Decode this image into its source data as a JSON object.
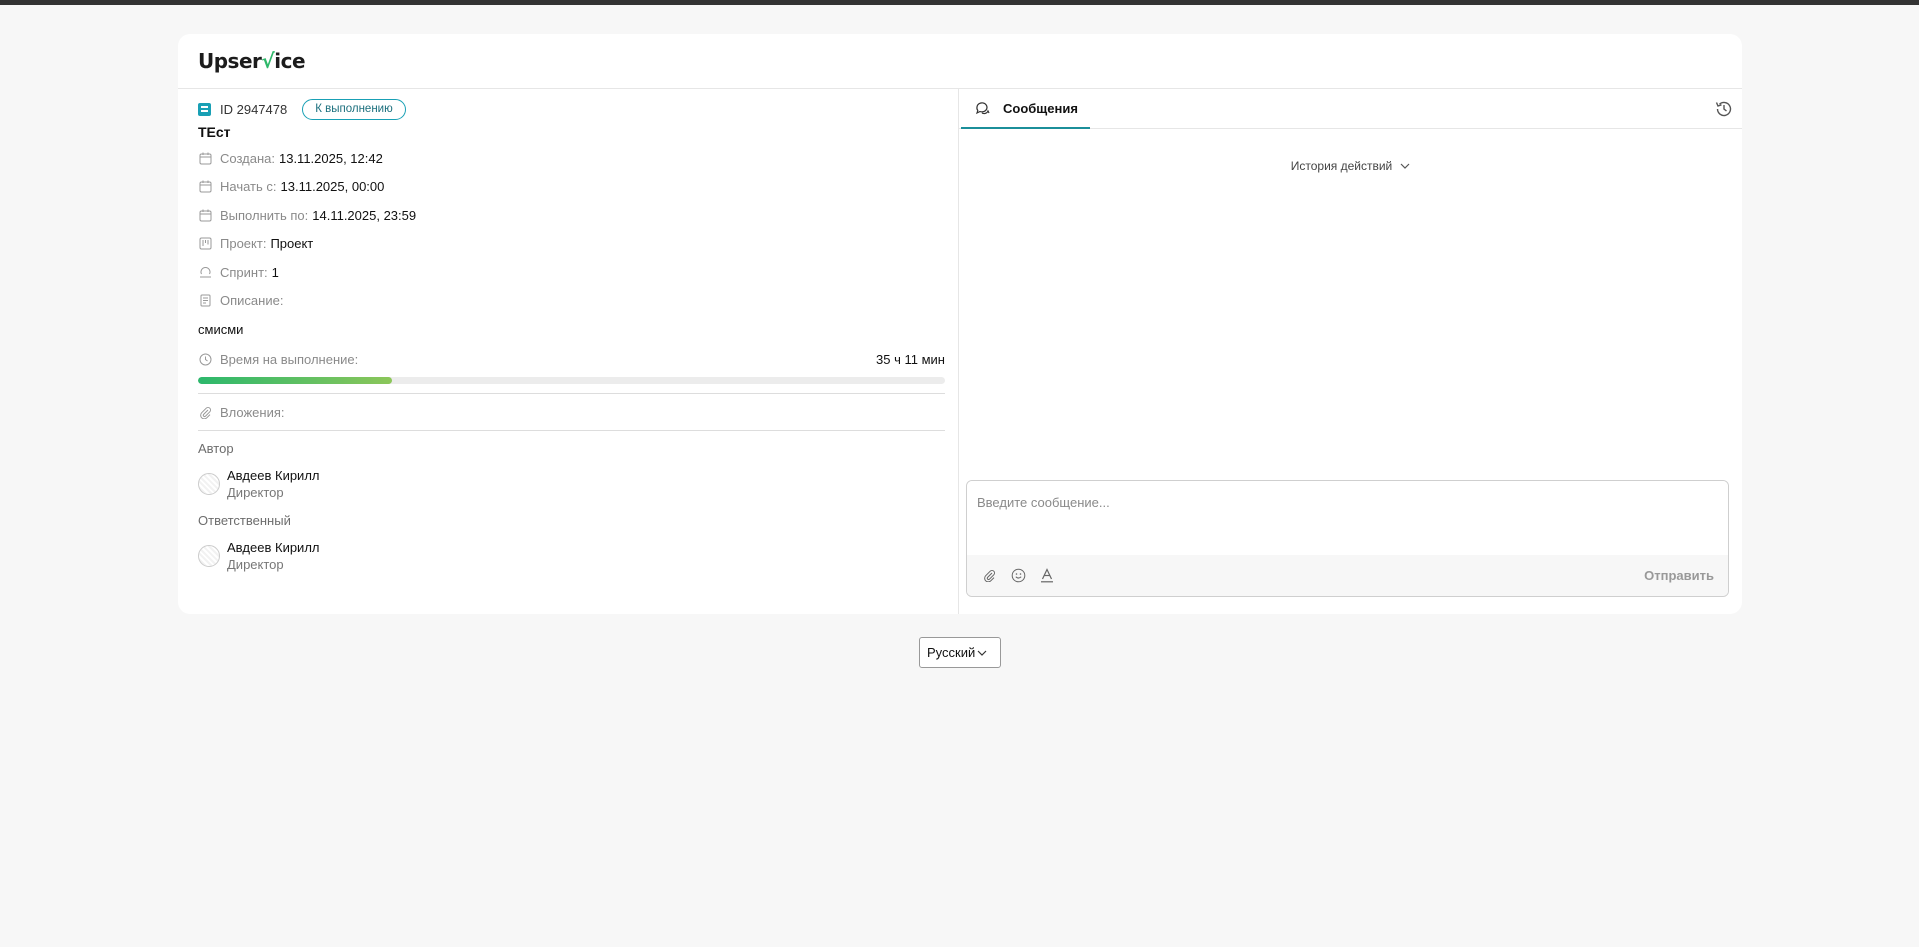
{
  "brand": {
    "name_left": "Upser",
    "name_check": "√",
    "name_right": "ice"
  },
  "task": {
    "id": "ID 2947478",
    "status": "К выполнению",
    "title": "ТЕст",
    "created_label": "Создана:",
    "created_value": "13.11.2025, 12:42",
    "start_label": "Начать с:",
    "start_value": "13.11.2025, 00:00",
    "due_label": "Выполнить по:",
    "due_value": "14.11.2025, 23:59",
    "project_label": "Проект:",
    "project_value": "Проект",
    "sprint_label": "Спринт:",
    "sprint_value": "1",
    "description_label": "Описание:",
    "description_value": "смисми",
    "time_label": "Время на выполнение:",
    "time_value": "35 ч 11 мин",
    "time_progress": 0.26,
    "attachments_label": "Вложения:",
    "author_label": "Автор",
    "author_name": "Авдеев Кирилл",
    "author_role": "Директор",
    "assignee_label": "Ответственный",
    "assignee_name": "Авдеев Кирилл",
    "assignee_role": "Директор"
  },
  "messages": {
    "tab_label": "Сообщения",
    "history_toggle": "История действий",
    "input_placeholder": "Введите сообщение...",
    "send_label": "Отправить"
  },
  "footer": {
    "language": "Русский"
  },
  "colors": {
    "accent": "#19a0b5",
    "progress_start": "#2cb86c",
    "progress_end": "#8cc65a",
    "logo_check": "#2eb86a"
  }
}
